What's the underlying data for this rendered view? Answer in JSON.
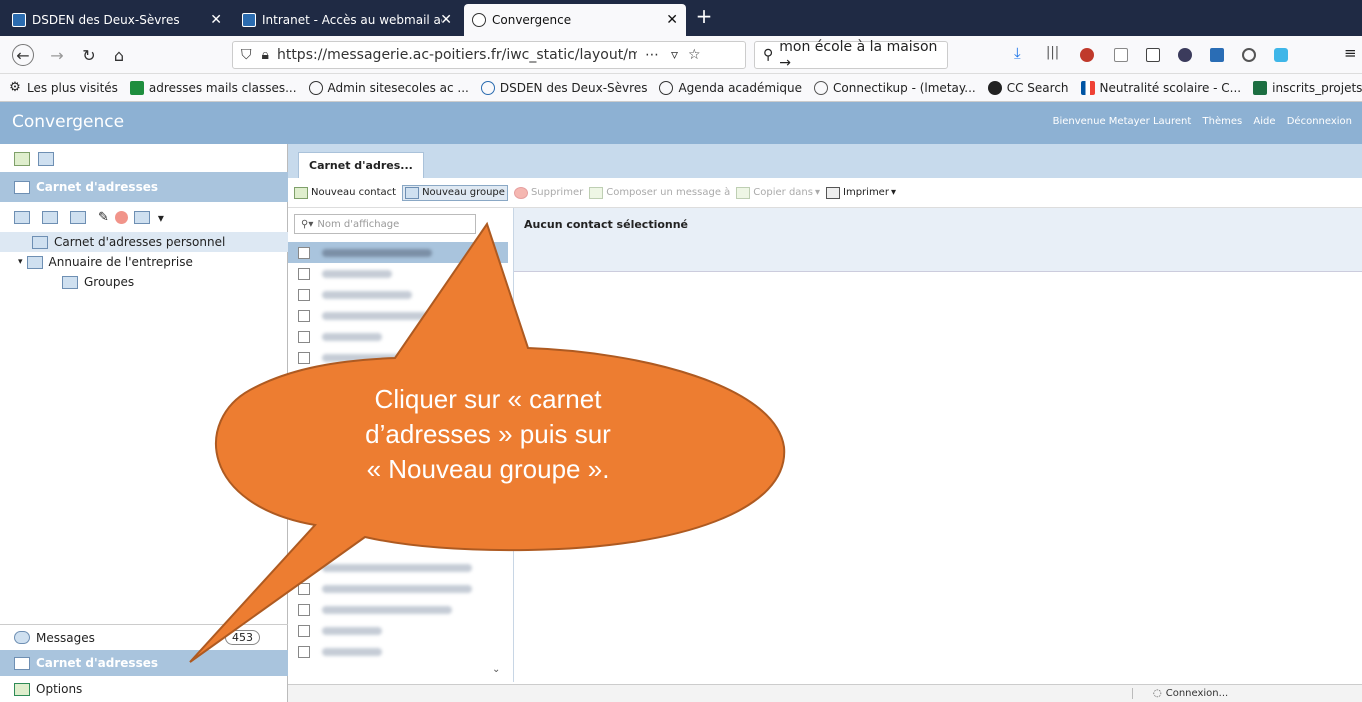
{
  "browser": {
    "tabs": [
      {
        "title": "DSDEN des Deux-Sèvres",
        "close": "✕"
      },
      {
        "title": "Intranet - Accès au webmail ac",
        "close": "✕"
      },
      {
        "title": "Convergence",
        "close": "✕"
      }
    ],
    "new_tab": "+",
    "url": "https://messagerie.ac-poitiers.fr/iwc_static/layout/mai",
    "page_actions": "⋯",
    "search_text": "mon école à la maison →",
    "bookmarks": [
      "Les plus visités",
      "adresses mails classes...",
      "Admin sitesecoles ac ...",
      "DSDEN des Deux-Sèvres",
      "Agenda académique",
      "Connectikup - (lmetay...",
      "CC Search",
      "Neutralité scolaire - C...",
      "inscrits_projets_numér..."
    ]
  },
  "app": {
    "title": "Convergence",
    "header_links": [
      "Bienvenue Metayer Laurent",
      "Thèmes",
      "Aide",
      "Déconnexion"
    ]
  },
  "left": {
    "section_title": "Carnet d'adresses",
    "tree": [
      "Carnet d'adresses personnel",
      "Annuaire de l'entreprise",
      "Groupes"
    ],
    "nav": [
      {
        "label": "Messages",
        "badge": "453"
      },
      {
        "label": "Carnet d'adresses"
      },
      {
        "label": "Options"
      }
    ]
  },
  "main": {
    "tab": "Carnet d'adres...",
    "toolbar": [
      "Nouveau contact",
      "Nouveau groupe",
      "Supprimer",
      "Composer un message à",
      "Copier dans",
      "Imprimer"
    ],
    "filter_placeholder": "Nom d'affichage",
    "no_selection": "Aucun contact sélectionné",
    "status": "Connexion..."
  },
  "callout": {
    "line1": "Cliquer sur « carnet",
    "line2": "d’adresses » puis sur",
    "line3": "« Nouveau groupe »."
  },
  "colors": {
    "header_blue": "#8db1d3",
    "section_blue": "#a9c4dd",
    "callout_orange": "#ed7d31",
    "callout_border": "#ae5a21"
  }
}
